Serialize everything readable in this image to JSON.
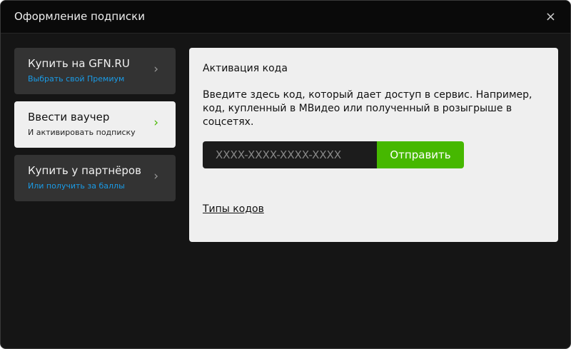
{
  "dialog": {
    "title": "Оформление подписки",
    "close_icon": "×"
  },
  "sidebar": {
    "items": [
      {
        "label": "Купить на GFN.RU",
        "sub": "Выбрать свой Премиум",
        "active": false
      },
      {
        "label": "Ввести ваучер",
        "sub": "И активировать подписку",
        "active": true
      },
      {
        "label": "Купить у партнёров",
        "sub": "Или получить за баллы",
        "active": false
      }
    ],
    "chevron": "›"
  },
  "panel": {
    "heading": "Активация кода",
    "description": "Введите здесь код, который дает доступ в сервис. Например, код, купленный в МВидео или полученный в розыгрыше в соцсетях.",
    "input_placeholder": "XXXX-XXXX-XXXX-XXXX",
    "input_value": "",
    "submit_label": "Отправить",
    "link": "Типы кодов"
  },
  "colors": {
    "accent": "#46b800",
    "link_blue": "#1a9be6"
  }
}
